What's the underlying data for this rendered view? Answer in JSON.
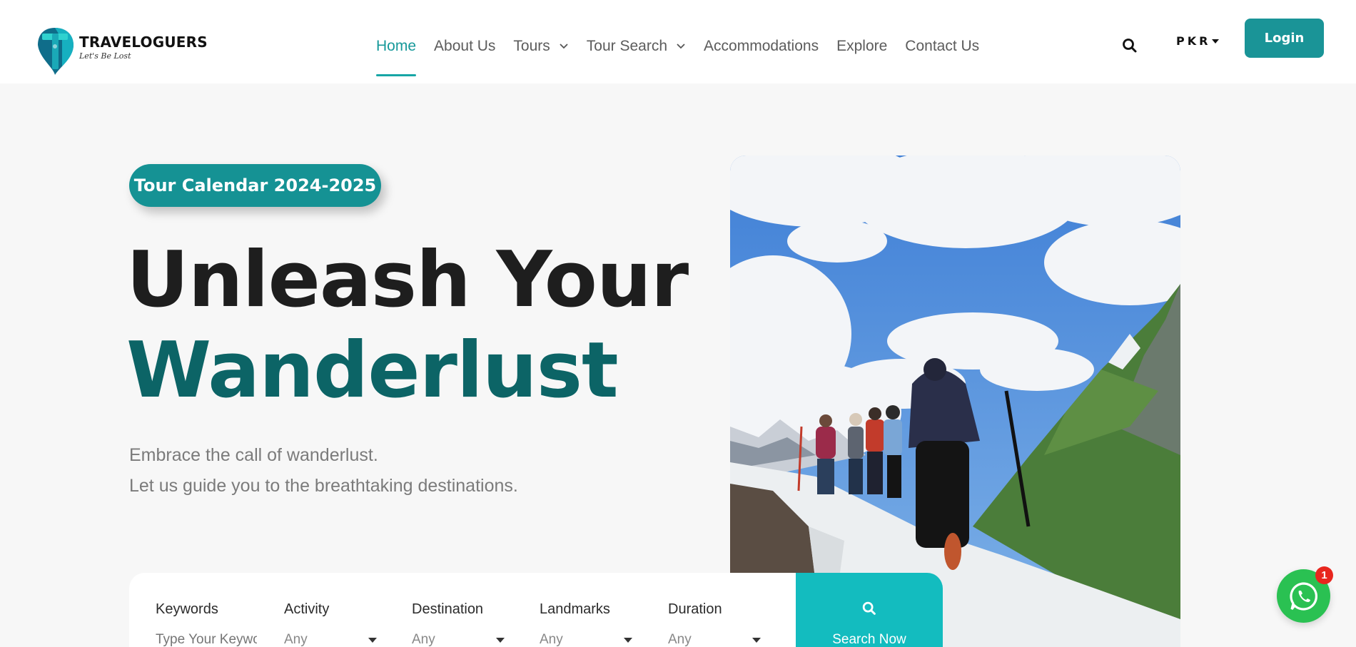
{
  "brand": {
    "name": "TRAVELOGUERS",
    "tagline": "Let's Be Lost",
    "accent": "#17999a",
    "dark_teal": "#0c6466"
  },
  "nav": {
    "items": [
      {
        "label": "Home",
        "active": true
      },
      {
        "label": "About Us"
      },
      {
        "label": "Tours",
        "dropdown": true
      },
      {
        "label": "Tour Search",
        "dropdown": true
      },
      {
        "label": "Accommodations"
      },
      {
        "label": "Explore"
      },
      {
        "label": "Contact Us"
      }
    ],
    "currency": "PKR",
    "login_label": "Login"
  },
  "hero": {
    "badge": "Tour Calendar 2024-2025",
    "title_line1": "Unleash Your",
    "title_line2": "Wanderlust",
    "subtitle_line1": "Embrace the call of wanderlust.",
    "subtitle_line2": "Let us guide you to the breathtaking destinations."
  },
  "search": {
    "keywords": {
      "label": "Keywords",
      "placeholder": "Type Your Keywords"
    },
    "activity": {
      "label": "Activity",
      "value": "Any"
    },
    "destination": {
      "label": "Destination",
      "value": "Any"
    },
    "landmarks": {
      "label": "Landmarks",
      "value": "Any"
    },
    "duration": {
      "label": "Duration",
      "value": "Any"
    },
    "button_label": "Search Now"
  },
  "whatsapp": {
    "badge_count": "1"
  }
}
